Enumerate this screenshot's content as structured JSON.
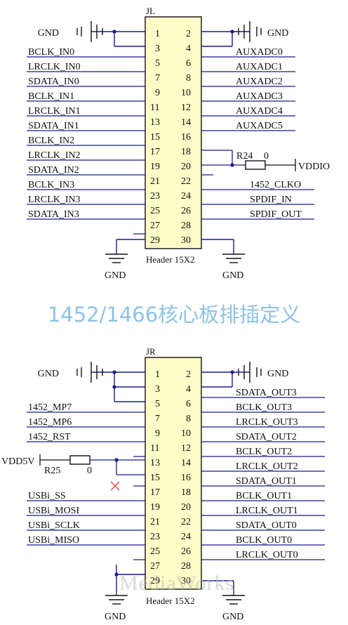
{
  "caption": "1452/1466核心板排插定义",
  "watermark": "MediaWorks",
  "connectors": [
    {
      "ref": "JL",
      "name": "Header 15X2",
      "pins": [
        "1",
        "2",
        "3",
        "4",
        "5",
        "6",
        "7",
        "8",
        "9",
        "10",
        "11",
        "12",
        "13",
        "14",
        "15",
        "16",
        "17",
        "18",
        "19",
        "20",
        "21",
        "22",
        "23",
        "24",
        "25",
        "26",
        "27",
        "28",
        "29",
        "30"
      ],
      "left_nets": [
        "GND",
        "BCLK_IN0",
        "LRCLK_IN0",
        "SDATA_IN0",
        "BCLK_IN1",
        "LRCLK_IN1",
        "SDATA_IN1",
        "BCLK_IN2",
        "LRCLK_IN2",
        "SDATA_IN2",
        "BCLK_IN3",
        "LRCLK_IN3",
        "SDATA_IN3"
      ],
      "right_nets": [
        "GND",
        "AUXADC0",
        "AUXADC1",
        "AUXADC2",
        "AUXADC3",
        "AUXADC4",
        "AUXADC5",
        "1452_CLKO",
        "SPDIF_IN",
        "SPDIF_OUT"
      ],
      "resistor": {
        "ref": "R24",
        "value": "0",
        "net": "VDDIO"
      },
      "bottom_nets": [
        "GND",
        "GND"
      ]
    },
    {
      "ref": "JR",
      "name": "Header 15X2",
      "pins": [
        "1",
        "2",
        "3",
        "4",
        "5",
        "6",
        "7",
        "8",
        "9",
        "10",
        "11",
        "12",
        "13",
        "14",
        "15",
        "16",
        "17",
        "18",
        "19",
        "20",
        "21",
        "22",
        "23",
        "24",
        "25",
        "26",
        "27",
        "28",
        "29",
        "30"
      ],
      "left_nets": [
        "GND",
        "1452_MP7",
        "1452_MP6",
        "1452_RST",
        "USBi_SS",
        "USBi_MOSI",
        "USBi_SCLK",
        "USBi_MISO"
      ],
      "right_nets": [
        "GND",
        "SDATA_OUT3",
        "BCLK_OUT3",
        "LRCLK_OUT3",
        "SDATA_OUT2",
        "BCLK_OUT2",
        "LRCLK_OUT2",
        "SDATA_OUT1",
        "BCLK_OUT1",
        "LRCLK_OUT1",
        "SDATA_OUT0",
        "BCLK_OUT0",
        "LRCLK_OUT0"
      ],
      "resistor": {
        "ref": "R25",
        "value": "0",
        "net": "VDD5V"
      },
      "bottom_nets": [
        "GND",
        "GND"
      ]
    }
  ]
}
